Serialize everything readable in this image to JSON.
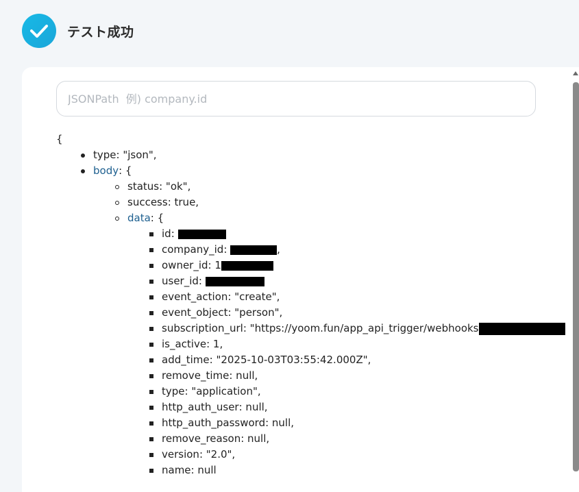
{
  "header": {
    "title": "テスト成功",
    "icon": "check-circle-icon",
    "accent_color": "#17b9e6"
  },
  "search": {
    "placeholder": "JSONPath  例) company.id",
    "value": ""
  },
  "json_view": {
    "open_brace": "{",
    "root": [
      {
        "key": "type",
        "value": ": \"json\","
      },
      {
        "key": "body",
        "value": ": {"
      }
    ],
    "body": [
      {
        "key": "status",
        "value": ": \"ok\","
      },
      {
        "key": "success",
        "value": ": true,"
      },
      {
        "key": "data",
        "value": ": {"
      }
    ],
    "data": [
      {
        "key": "id",
        "value": ": "
      },
      {
        "key": "company_id",
        "value": ": "
      },
      {
        "key": "owner_id",
        "value": ": 1"
      },
      {
        "key": "user_id",
        "value": ": "
      },
      {
        "key": "event_action",
        "value": ": \"create\","
      },
      {
        "key": "event_object",
        "value": ": \"person\","
      },
      {
        "key": "subscription_url",
        "value": ": \"https://yoom.fun/app_api_trigger/webhooks"
      },
      {
        "key": "is_active",
        "value": ": 1,"
      },
      {
        "key": "add_time",
        "value": ": \"2025-10-03T03:55:42.000Z\","
      },
      {
        "key": "remove_time",
        "value": ": null,"
      },
      {
        "key": "type",
        "value": ": \"application\","
      },
      {
        "key": "http_auth_user",
        "value": ": null,"
      },
      {
        "key": "http_auth_password",
        "value": ": null,"
      },
      {
        "key": "remove_reason",
        "value": ": null,"
      },
      {
        "key": "version",
        "value": ": \"2.0\","
      },
      {
        "key": "name",
        "value": ": null"
      }
    ],
    "redaction_suffix": ","
  }
}
